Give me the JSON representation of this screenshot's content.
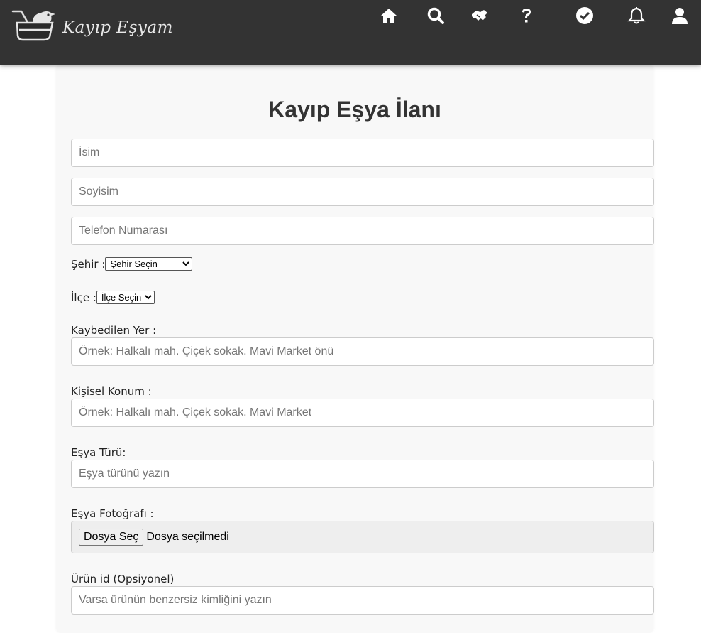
{
  "header": {
    "logo_text": "Kayıp Eşyam",
    "background": "#333333",
    "nav": [
      {
        "icon": "home-icon"
      },
      {
        "icon": "search-icon"
      },
      {
        "icon": "handshake-icon"
      },
      {
        "icon": "question-icon"
      },
      {
        "icon": "check-circle-icon"
      },
      {
        "icon": "bell-icon"
      },
      {
        "icon": "user-icon"
      }
    ]
  },
  "form": {
    "title": "Kayıp Eşya İlanı",
    "first_name_placeholder": "İsim",
    "last_name_placeholder": "Soyisim",
    "phone_placeholder": "Telefon Numarası",
    "city_label": "Şehir :",
    "city_selected": "Şehir Seçin",
    "district_label": "İlçe :",
    "district_selected": "İlçe Seçin",
    "lost_place_label": "Kaybedilen Yer :",
    "lost_place_placeholder": "Örnek: Halkalı mah. Çiçek sokak. Mavi Market önü",
    "personal_location_label": "Kişisel Konum :",
    "personal_location_placeholder": "Örnek: Halkalı mah. Çiçek sokak. Mavi Market",
    "item_type_label": "Eşya Türü:",
    "item_type_placeholder": "Eşya türünü yazın",
    "photo_label": "Eşya Fotoğrafı :",
    "file_button": "Dosya Seç",
    "file_status": "Dosya seçilmedi",
    "product_id_label": "Ürün id (Opsiyonel)",
    "product_id_placeholder": "Varsa ürünün benzersiz kimliğini yazın"
  }
}
